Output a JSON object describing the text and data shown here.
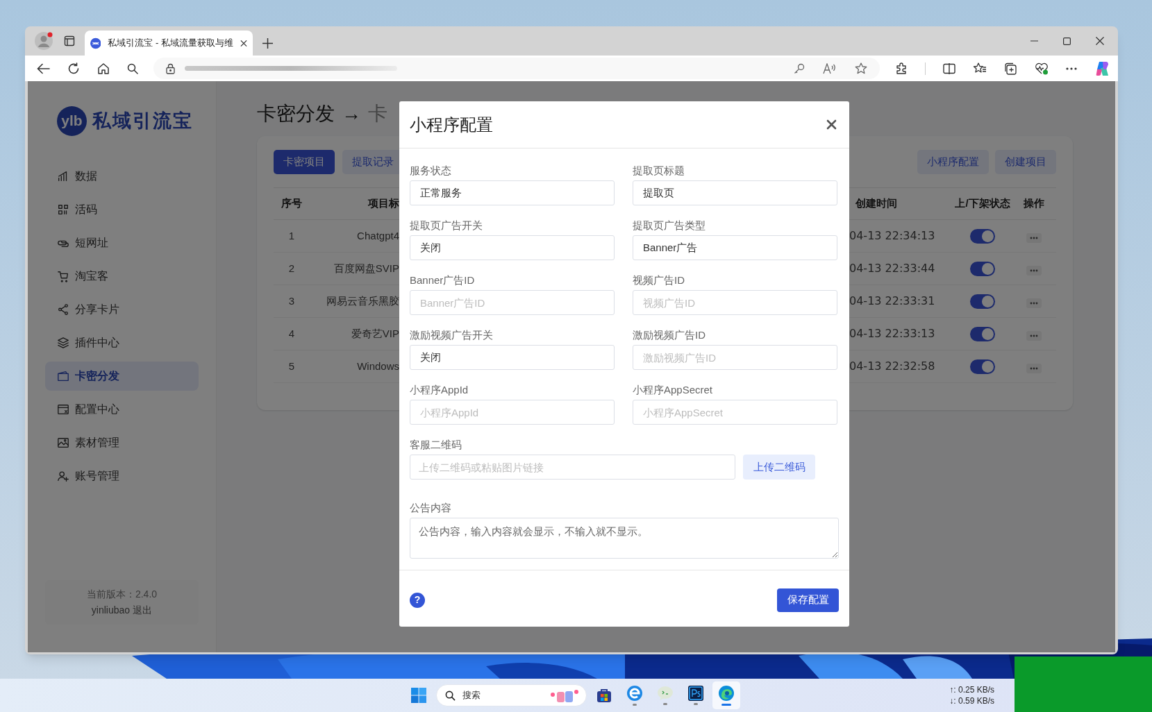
{
  "browser": {
    "tab": {
      "title": "私域引流宝 - 私域流量获取与维"
    }
  },
  "sidebar": {
    "logo_mark": "ylb",
    "logo_text": "私域引流宝",
    "items": [
      {
        "label": "数据",
        "selected": false
      },
      {
        "label": "活码",
        "selected": false
      },
      {
        "label": "短网址",
        "selected": false
      },
      {
        "label": "淘宝客",
        "selected": false
      },
      {
        "label": "分享卡片",
        "selected": false
      },
      {
        "label": "插件中心",
        "selected": false
      },
      {
        "label": "卡密分发",
        "selected": true
      },
      {
        "label": "配置中心",
        "selected": false
      },
      {
        "label": "素材管理",
        "selected": false
      },
      {
        "label": "账号管理",
        "selected": false
      }
    ],
    "version": "当前版本：2.4.0",
    "user": "yinliubao",
    "logout": "退出"
  },
  "page": {
    "title": "卡密分发",
    "arrow": "→",
    "subtitle": "卡",
    "tabs": [
      {
        "label": "卡密项目",
        "selected": true
      },
      {
        "label": "提取记录",
        "selected": false
      }
    ],
    "actions": [
      "小程序配置",
      "创建项目"
    ],
    "table": {
      "columns": [
        "序号",
        "项目标",
        "创建时间",
        "上/下架状态",
        "操作"
      ],
      "rows": [
        {
          "index": "1",
          "title": "Chatgpt4",
          "created": "04-13 22:34:13",
          "on": true
        },
        {
          "index": "2",
          "title": "百度网盘SVIP",
          "created": "04-13 22:33:44",
          "on": true
        },
        {
          "index": "3",
          "title": "网易云音乐黑胶",
          "created": "04-13 22:33:31",
          "on": true
        },
        {
          "index": "4",
          "title": "爱奇艺VIP",
          "created": "04-13 22:33:13",
          "on": true
        },
        {
          "index": "5",
          "title": "Windows",
          "created": "04-13 22:32:58",
          "on": true
        }
      ]
    }
  },
  "modal": {
    "title": "小程序配置",
    "fields": [
      {
        "label": "服务状态",
        "value": "正常服务"
      },
      {
        "label": "提取页标题",
        "value": "提取页"
      },
      {
        "label": "提取页广告开关",
        "value": "关闭"
      },
      {
        "label": "提取页广告类型",
        "value": "Banner广告"
      },
      {
        "label": "Banner广告ID",
        "placeholder": "Banner广告ID"
      },
      {
        "label": "视频广告ID",
        "placeholder": "视频广告ID"
      },
      {
        "label": "激励视频广告开关",
        "value": "关闭"
      },
      {
        "label": "激励视频广告ID",
        "placeholder": "激励视频广告ID"
      },
      {
        "label": "小程序AppId",
        "placeholder": "小程序AppId"
      },
      {
        "label": "小程序AppSecret",
        "placeholder": "小程序AppSecret"
      }
    ],
    "qr": {
      "label": "客服二维码",
      "placeholder": "上传二维码或粘贴图片链接",
      "button": "上传二维码"
    },
    "notice": {
      "label": "公告内容",
      "placeholder": "公告内容，输入内容就会显示，不输入就不显示。"
    },
    "help": "?",
    "save": "保存配置"
  },
  "taskbar": {
    "search": "搜索",
    "upload": "↑: 0.25 KB/s",
    "download": "↓: 0.59 KB/s"
  }
}
